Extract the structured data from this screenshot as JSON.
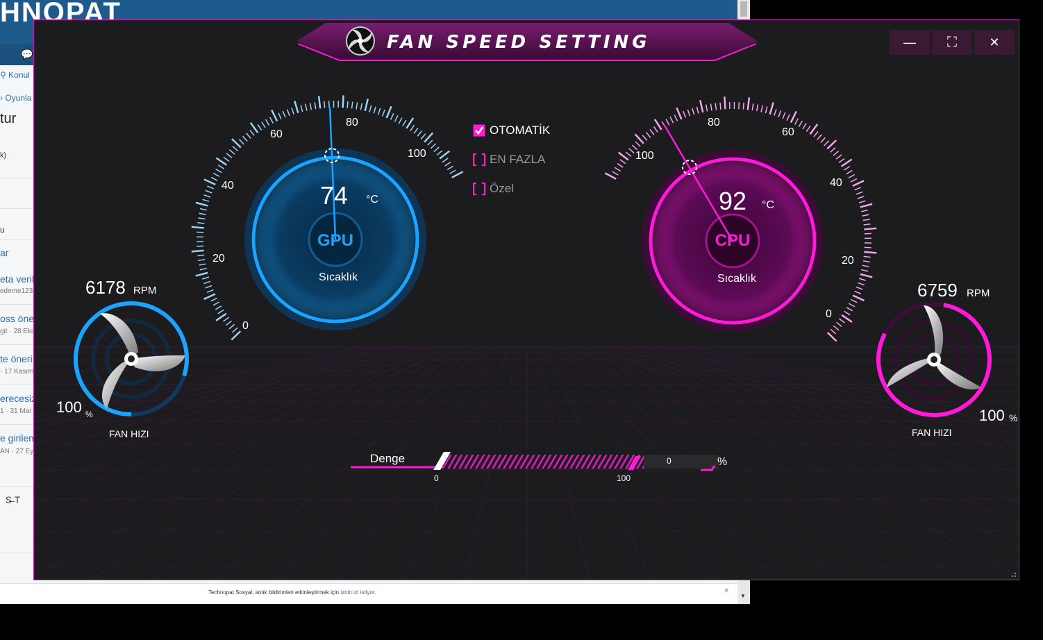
{
  "background": {
    "logo": "HNOPAT",
    "nav_links": [
      "Konul",
      "Oyunla"
    ],
    "heading": "tur",
    "tag": "k)",
    "tab": "u",
    "items": [
      {
        "title": "ar",
        "meta": ""
      },
      {
        "title": "eta veril",
        "meta": "edeme123"
      },
      {
        "title": "oss öne",
        "meta": "git · 28 Eki"
      },
      {
        "title": "te öneri",
        "meta": "· 17 Kasım"
      },
      {
        "title": "erecesiz",
        "meta": "1 · 31 Mar"
      },
      {
        "title": "e girilem",
        "meta": "AN · 27 Eyl"
      }
    ],
    "notification": {
      "text": "Technopat Sosyal, anlık bildirimleri etkinleştirmek için",
      "link": "iznin izi istiyor.",
      "close": "×"
    }
  },
  "window": {
    "title": "FAN SPEED SETTING",
    "controls": {
      "minimize": "—",
      "maximize": "⛶",
      "close": "✕"
    }
  },
  "gpu": {
    "label": "GPU",
    "temp_label": "Sıcaklık",
    "temperature": "74",
    "unit": "°C",
    "scale": [
      "0",
      "20",
      "40",
      "60",
      "80",
      "100"
    ],
    "fan": {
      "rpm": "6178",
      "rpm_unit": "RPM",
      "percent": "100",
      "percent_unit": "%",
      "label": "FAN HIZI"
    }
  },
  "cpu": {
    "label": "CPU",
    "temp_label": "Sıcaklık",
    "temperature": "92",
    "unit": "°C",
    "scale": [
      "0",
      "20",
      "40",
      "60",
      "80",
      "100"
    ],
    "fan": {
      "rpm": "6759",
      "rpm_unit": "RPM",
      "percent": "100",
      "percent_unit": "%",
      "label": "FAN HIZI"
    }
  },
  "modes": [
    {
      "label": "OTOMATİK",
      "checked": true
    },
    {
      "label": "EN FAZLA",
      "checked": false
    },
    {
      "label": "Özel",
      "checked": false
    }
  ],
  "balance": {
    "label": "Denge",
    "min": "0",
    "max": "100",
    "value": "0",
    "unit": "%"
  },
  "colors": {
    "gpu_accent": "#1aa3ff",
    "cpu_accent": "#ff1ad9",
    "window_bg": "#1c1c1f",
    "title_bar": "#5b1553"
  }
}
